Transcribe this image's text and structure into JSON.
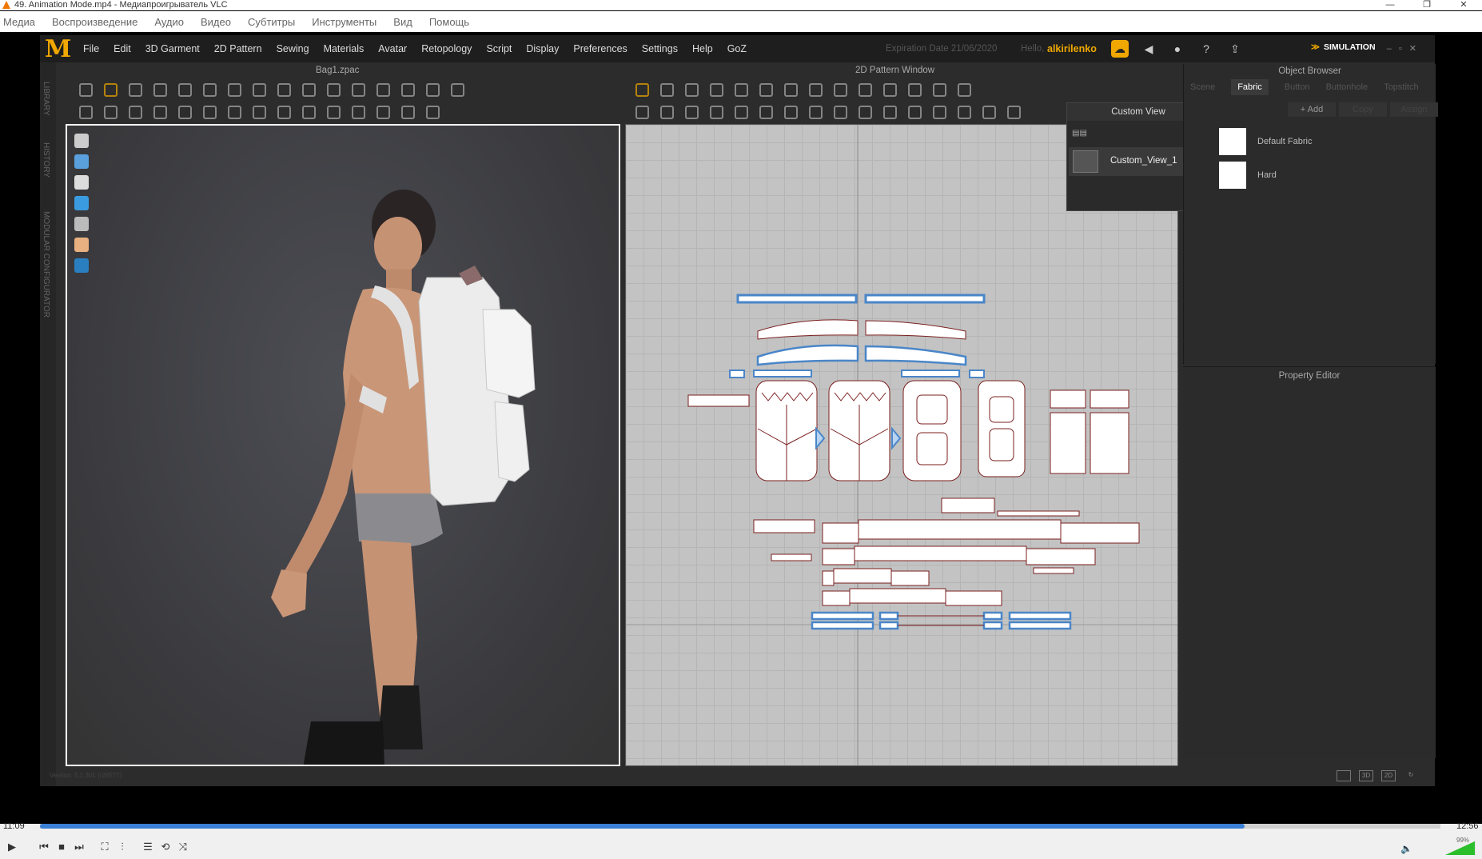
{
  "vlc": {
    "window_title": "49. Animation Mode.mp4 - Медиапроигрыватель VLC",
    "menu": [
      "Медиа",
      "Воспроизведение",
      "Аудио",
      "Видео",
      "Субтитры",
      "Инструменты",
      "Вид",
      "Помощь"
    ],
    "time_elapsed": "11:09",
    "time_total": "12:56",
    "progress_fraction": 0.86,
    "volume": "99%",
    "accent_color": "#3a80d6"
  },
  "md": {
    "logo": "M",
    "menu": [
      "File",
      "Edit",
      "3D Garment",
      "2D Pattern",
      "Sewing",
      "Materials",
      "Avatar",
      "Retopology",
      "Script",
      "Display",
      "Preferences",
      "Settings",
      "Help",
      "GoZ"
    ],
    "expiration_label": "Expiration Date 21/06/2020",
    "hello_label": "Hello,",
    "username": "alkirilenko",
    "mode_label": "SIMULATION",
    "file_name": "Bag1.zpac",
    "pattern_window_title": "2D Pattern Window",
    "side_tabs": [
      "LIBRARY",
      "HISTORY",
      "MODULAR CONFIGURATOR"
    ],
    "version": "Version: 5.1.301 (r28577)",
    "brand_color": "#f0a800"
  },
  "custom_view": {
    "title": "Custom View",
    "items": [
      {
        "name": "Custom_View_1"
      }
    ]
  },
  "object_browser": {
    "title": "Object Browser",
    "tabs": [
      "Scene",
      "Fabric",
      "Button",
      "Buttonhole",
      "Topstitch"
    ],
    "active_tab": "Fabric",
    "buttons": {
      "add": "+ Add",
      "copy": "Copy",
      "assign": "Assign"
    },
    "fabrics": [
      {
        "name": "Default Fabric"
      },
      {
        "name": "Hard"
      }
    ]
  },
  "property_editor": {
    "title": "Property Editor"
  }
}
